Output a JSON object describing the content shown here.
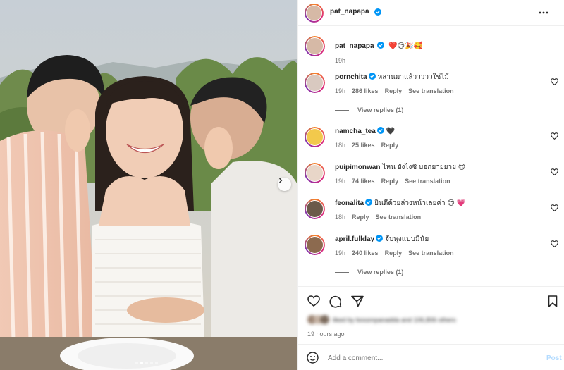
{
  "post": {
    "author": "pat_napapa",
    "more_icon": "more-horizontal-icon",
    "caption_emojis": "❤️😍🎉🥰",
    "caption_time": "19h"
  },
  "comments": [
    {
      "user": "pornchita",
      "verified": true,
      "text": "หลานมาแล้วววววใช่ไม้",
      "time": "19h",
      "likes": "286 likes",
      "reply": "Reply",
      "translate": "See translation",
      "replies": "View replies (1)",
      "avatar_color": "#d9c9c0"
    },
    {
      "user": "namcha_tea",
      "verified": true,
      "text": "🖤",
      "time": "18h",
      "likes": "25 likes",
      "reply": "Reply",
      "translate": "",
      "replies": "",
      "avatar_color": "#f2c94c"
    },
    {
      "user": "puipimonwan",
      "verified": false,
      "text": "ไหน ยังไงซิ บอกยายยาย 😍",
      "time": "19h",
      "likes": "74 likes",
      "reply": "Reply",
      "translate": "See translation",
      "replies": "",
      "avatar_color": "#e8d6c8"
    },
    {
      "user": "feonalita",
      "verified": true,
      "text": "ยินดีด้วยล่วงหน้าเลยค่า 😍 💗",
      "time": "18h",
      "likes": "",
      "reply": "Reply",
      "translate": "See translation",
      "replies": "",
      "avatar_color": "#6b5a4a"
    },
    {
      "user": "april.fullday",
      "verified": true,
      "text": "จับพุงแบบมีนัย",
      "time": "19h",
      "likes": "240 likes",
      "reply": "Reply",
      "translate": "See translation",
      "replies": "View replies (1)",
      "avatar_color": "#8c6a4f"
    }
  ],
  "actions": {
    "like_icon": "heart-icon",
    "comment_icon": "comment-icon",
    "share_icon": "send-icon",
    "save_icon": "bookmark-icon"
  },
  "liked_by_text": "liked by bossmpanadda and 106,806 others",
  "time_ago": "19 hours ago",
  "add_comment": {
    "placeholder": "Add a comment...",
    "post_label": "Post",
    "emoji_icon": "smiley-icon"
  },
  "carousel": {
    "total_slides": 5,
    "current_slide": 2
  }
}
